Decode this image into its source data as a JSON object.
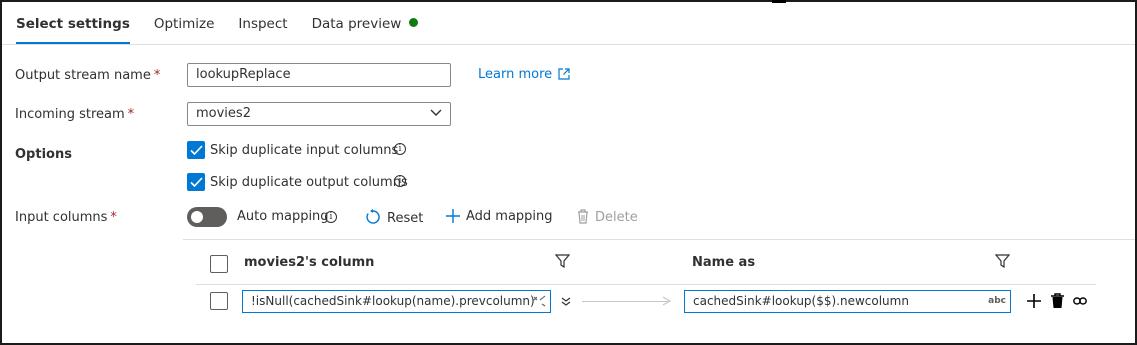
{
  "tabs": [
    {
      "label": "Select settings",
      "active": true
    },
    {
      "label": "Optimize",
      "active": false
    },
    {
      "label": "Inspect",
      "active": false
    },
    {
      "label": "Data preview",
      "active": false
    }
  ],
  "colors": {
    "accent": "#0078d4",
    "status": "#107c10",
    "required": "#a4262c"
  },
  "form": {
    "output_stream": {
      "label": "Output stream name",
      "required": "*",
      "value": "lookupReplace"
    },
    "learn_more": "Learn more",
    "incoming_stream": {
      "label": "Incoming stream",
      "required": "*",
      "value": "movies2"
    },
    "options_label": "Options",
    "skip_input": {
      "label": "Skip duplicate input columns",
      "checked": true
    },
    "skip_output": {
      "label": "Skip duplicate output columns",
      "checked": true
    },
    "input_columns": {
      "label": "Input columns",
      "required": "*"
    }
  },
  "toolbar": {
    "auto_mapping": "Auto mapping",
    "auto_mapping_on": false,
    "reset": "Reset",
    "add_mapping": "Add mapping",
    "delete": "Delete"
  },
  "grid": {
    "headers": {
      "source": "movies2's column",
      "target": "Name as"
    },
    "rows": [
      {
        "expression": "!isNull(cachedSink#lookup(name).prevcolumn)",
        "name_as": "cachedSink#lookup($$).newcolumn",
        "type_badge": "abc"
      }
    ]
  }
}
